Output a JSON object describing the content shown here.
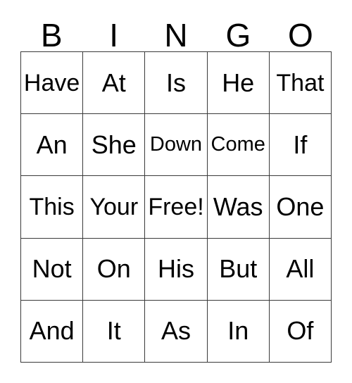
{
  "card": {
    "header_letters": [
      "B",
      "I",
      "N",
      "G",
      "O"
    ],
    "rows": [
      [
        {
          "label": "Have",
          "size": "tight",
          "free": false
        },
        {
          "label": "At",
          "size": "normal",
          "free": false
        },
        {
          "label": "Is",
          "size": "normal",
          "free": false
        },
        {
          "label": "He",
          "size": "normal",
          "free": false
        },
        {
          "label": "That",
          "size": "tight",
          "free": false
        }
      ],
      [
        {
          "label": "An",
          "size": "normal",
          "free": false
        },
        {
          "label": "She",
          "size": "normal",
          "free": false
        },
        {
          "label": "Down",
          "size": "fit",
          "free": false
        },
        {
          "label": "Come",
          "size": "fit",
          "free": false
        },
        {
          "label": "If",
          "size": "normal",
          "free": false
        }
      ],
      [
        {
          "label": "This",
          "size": "tight",
          "free": false
        },
        {
          "label": "Your",
          "size": "tight",
          "free": false
        },
        {
          "label": "Free!",
          "size": "tight",
          "free": true
        },
        {
          "label": "Was",
          "size": "normal",
          "free": false
        },
        {
          "label": "One",
          "size": "normal",
          "free": false
        }
      ],
      [
        {
          "label": "Not",
          "size": "normal",
          "free": false
        },
        {
          "label": "On",
          "size": "normal",
          "free": false
        },
        {
          "label": "His",
          "size": "normal",
          "free": false
        },
        {
          "label": "But",
          "size": "normal",
          "free": false
        },
        {
          "label": "All",
          "size": "normal",
          "free": false
        }
      ],
      [
        {
          "label": "And",
          "size": "normal",
          "free": false
        },
        {
          "label": "It",
          "size": "normal",
          "free": false
        },
        {
          "label": "As",
          "size": "normal",
          "free": false
        },
        {
          "label": "In",
          "size": "normal",
          "free": false
        },
        {
          "label": "Of",
          "size": "normal",
          "free": false
        }
      ]
    ],
    "colors": {
      "background": "#ffffff",
      "grid_line": "#3a3a3a",
      "text": "#000000"
    }
  }
}
